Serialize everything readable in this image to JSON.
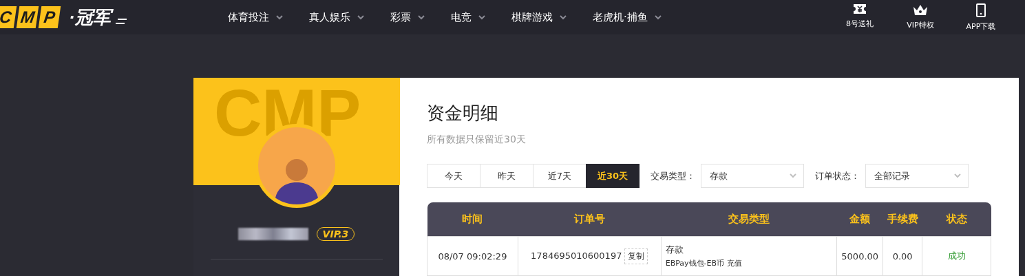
{
  "header": {
    "logo": {
      "letters": [
        "C",
        "M",
        "P"
      ],
      "text": "·冠军"
    },
    "nav": [
      {
        "label": "体育投注"
      },
      {
        "label": "真人娱乐"
      },
      {
        "label": "彩票"
      },
      {
        "label": "电竞"
      },
      {
        "label": "棋牌游戏"
      },
      {
        "label": "老虎机·捕鱼"
      }
    ],
    "actions": [
      {
        "kind": "ticket",
        "label": "8号送礼"
      },
      {
        "kind": "crown",
        "label": "VIP特权"
      },
      {
        "kind": "phone",
        "label": "APP下载"
      }
    ]
  },
  "profile": {
    "backdrop_text": "CMP",
    "vip": "VIP.3"
  },
  "content": {
    "title": "资金明细",
    "subtitle": "所有数据只保留近30天",
    "ranges": [
      {
        "label": "今天",
        "selected": false
      },
      {
        "label": "昨天",
        "selected": false
      },
      {
        "label": "近7天",
        "selected": false
      },
      {
        "label": "近30天",
        "selected": true
      }
    ],
    "filters": [
      {
        "label": "交易类型：",
        "value": "存款"
      },
      {
        "label": "订单状态：",
        "value": "全部记录"
      }
    ],
    "table": {
      "columns": [
        "时间",
        "订单号",
        "交易类型",
        "金额",
        "手续费",
        "状态"
      ],
      "rows": [
        {
          "time": "08/07 09:02:29",
          "order": "1784695010600197",
          "copy": "复制",
          "type": "存款",
          "detail": "EBPay钱包-EB币 充值",
          "amount": "5000.00",
          "fee": "0.00",
          "status": "成功",
          "kind": "success"
        }
      ]
    }
  }
}
